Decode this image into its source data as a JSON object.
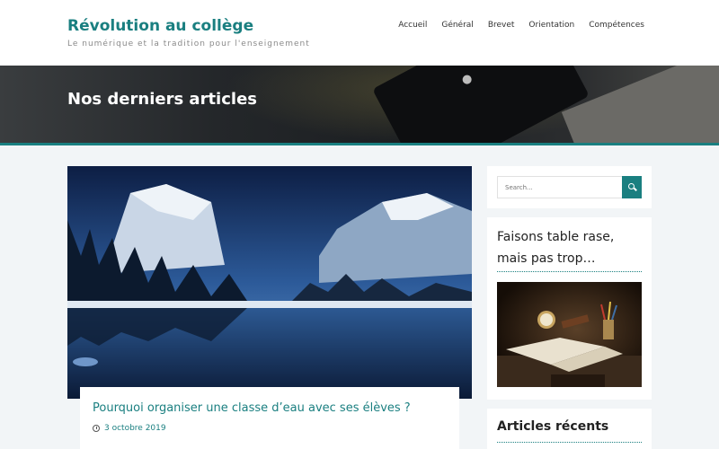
{
  "header": {
    "site_title": "Révolution au collège",
    "site_description": "Le numérique et la tradition pour l'enseignement",
    "nav": [
      "Accueil",
      "Général",
      "Brevet",
      "Orientation",
      "Compétences"
    ]
  },
  "banner": {
    "title": "Nos derniers articles"
  },
  "post": {
    "title": "Pourquoi organiser une classe d’eau avec ses élèves ?",
    "date": "3 octobre 2019",
    "image_alt": "mountain-lake-landscape"
  },
  "sidebar": {
    "search": {
      "placeholder": "Search..."
    },
    "featured": {
      "title": "Faisons table rase, mais pas trop…"
    },
    "recent": {
      "title": "Articles récents"
    }
  },
  "colors": {
    "accent": "#1a7f80",
    "background": "#f2f5f7"
  }
}
